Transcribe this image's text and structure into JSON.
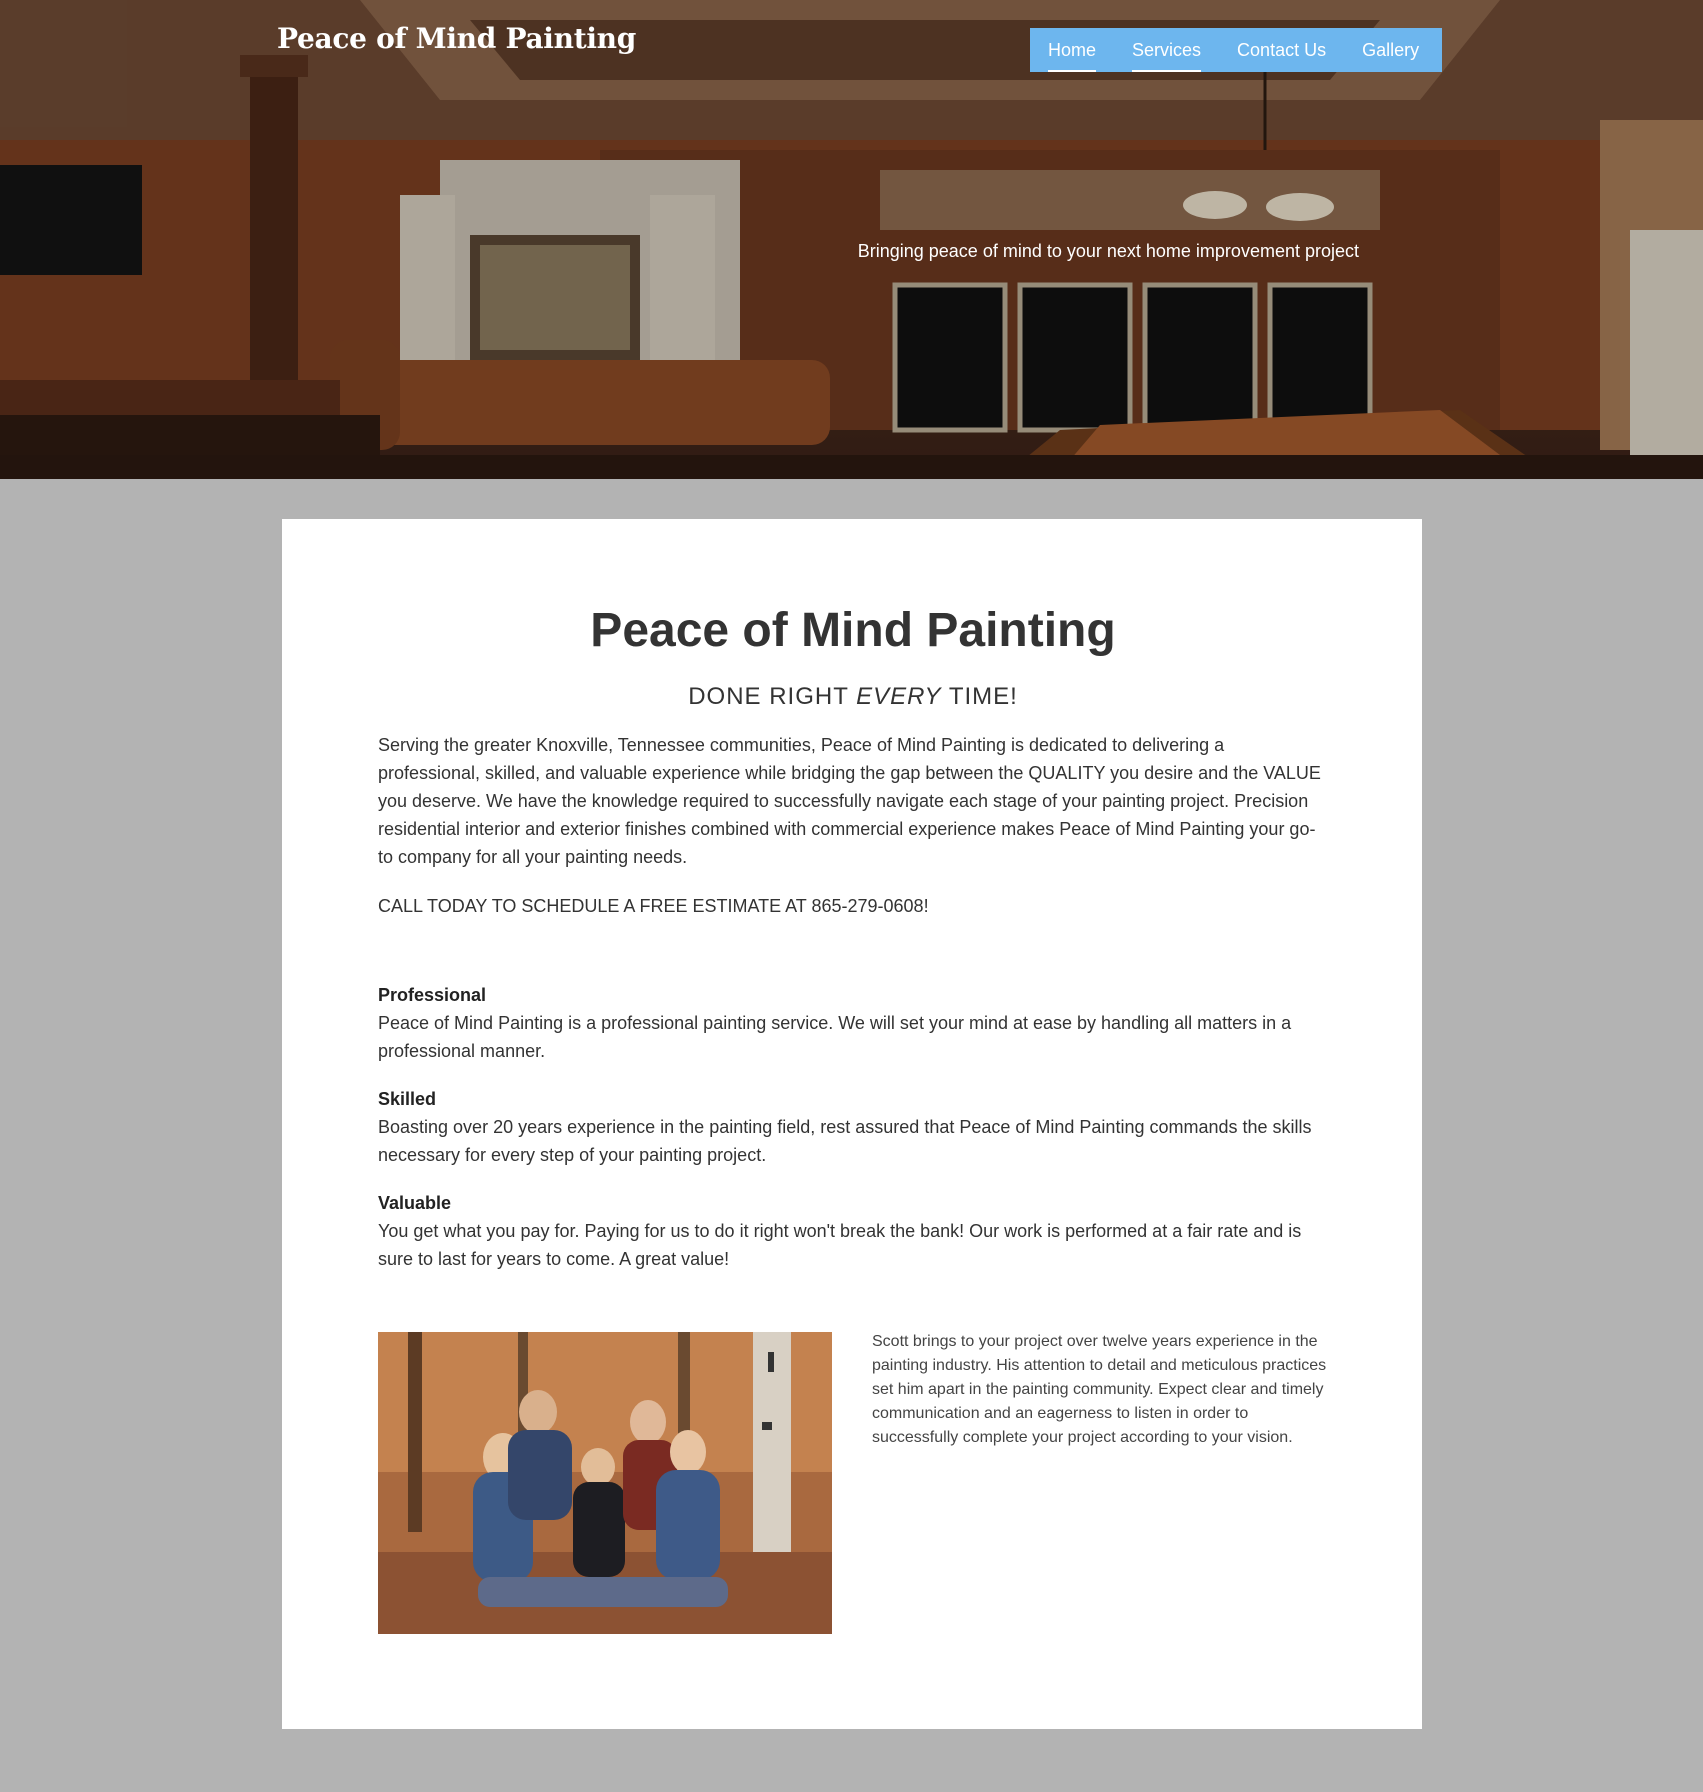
{
  "header": {
    "site_title": "Peace of Mind Painting",
    "tagline": "Bringing peace of mind to your next home improvement project",
    "nav": [
      {
        "label": "Home",
        "active": true
      },
      {
        "label": "Services",
        "active": true
      },
      {
        "label": "Contact Us",
        "active": false
      },
      {
        "label": "Gallery",
        "active": false
      }
    ],
    "nav_color": "#6db6ee"
  },
  "main": {
    "title": "Peace of Mind Painting",
    "subtitle_pre": "DONE RIGHT ",
    "subtitle_em": "EVERY",
    "subtitle_post": " TIME!",
    "intro": "Serving the greater Knoxville, Tennessee communities, Peace of Mind Painting is dedicated to delivering a professional, skilled, and valuable experience while bridging the gap between the QUALITY you desire and the VALUE you deserve. We have the knowledge required to successfully navigate each stage of your painting project. Precision residential interior and exterior finishes combined with commercial experience makes Peace of Mind Painting your go-to company for all your painting needs.",
    "cta": "CALL TODAY TO SCHEDULE A FREE ESTIMATE AT 865-279-0608!",
    "features": [
      {
        "heading": "Professional",
        "text": "Peace of Mind Painting is a professional painting service. We will set your mind at ease by handling all matters in a professional manner."
      },
      {
        "heading": "Skilled",
        "text": "Boasting over 20 years experience in the painting field, rest assured that Peace of Mind Painting commands the skills necessary for every step of your painting project."
      },
      {
        "heading": "Valuable",
        "text": "You get what you pay for. Paying for us to do it right won't break the bank! Our work is performed at a fair rate and is sure to last for years to come. A great value!"
      }
    ],
    "bio": "Scott brings to your project over twelve years experience in the painting industry. His attention to detail and meticulous practices set him apart in the painting community. Expect clear and timely communication and an eagerness to listen in order to successfully complete your project according to your vision."
  }
}
